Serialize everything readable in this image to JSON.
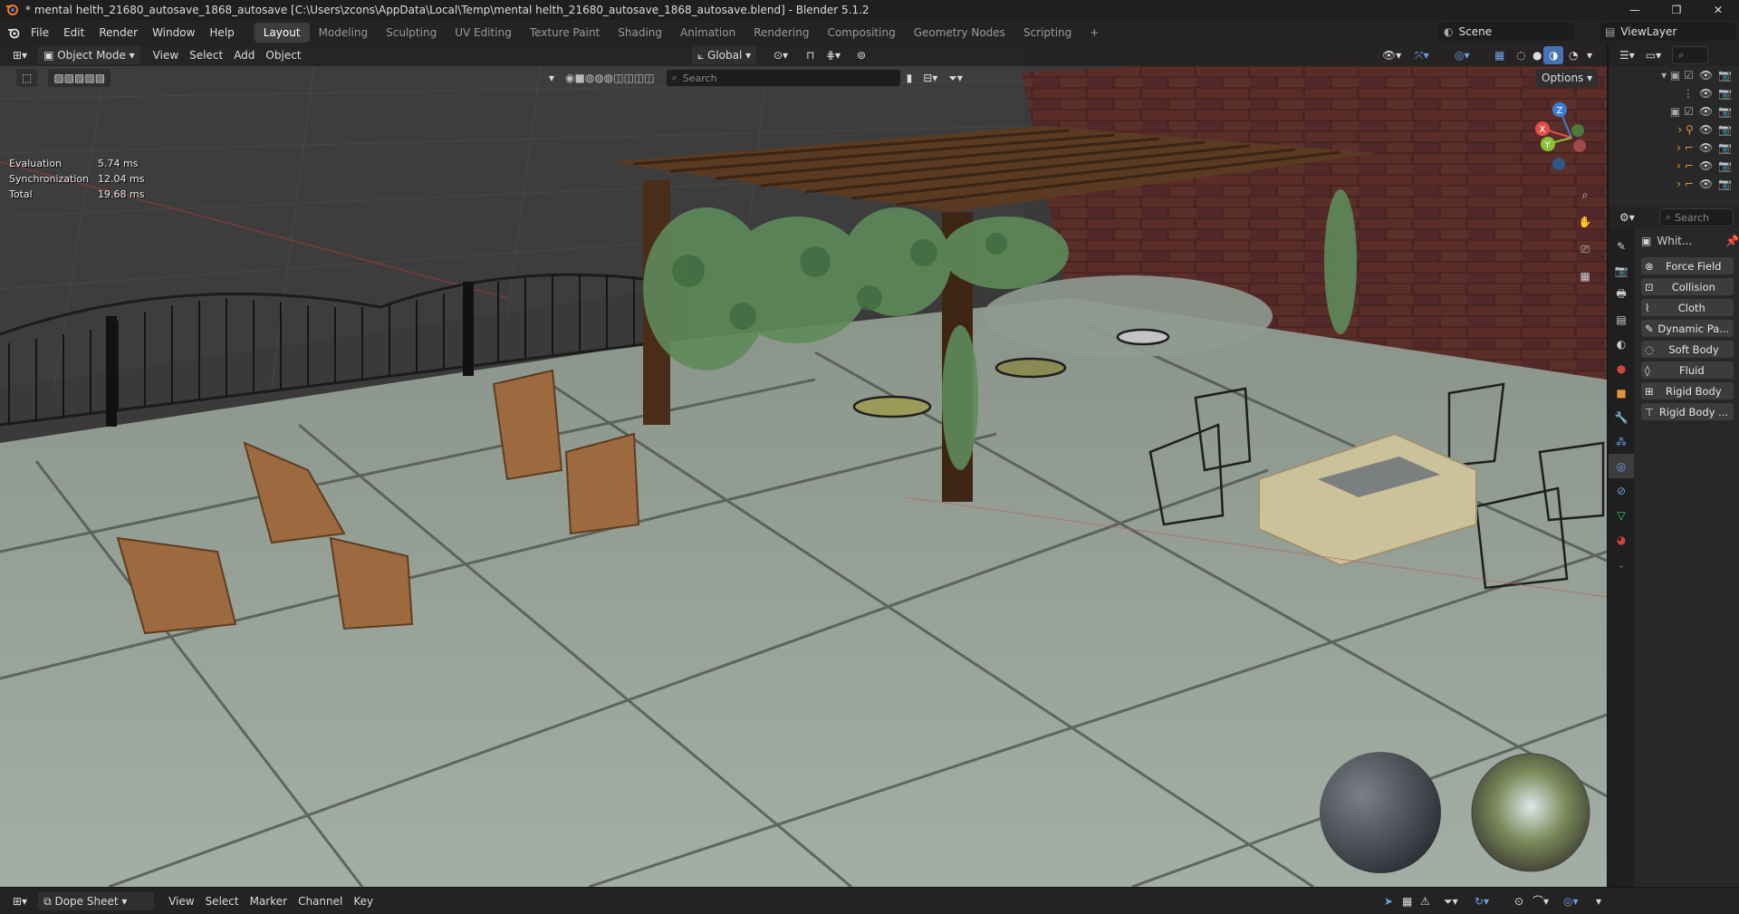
{
  "window": {
    "title": "* mental helth_21680_autosave_1868_autosave [C:\\Users\\zcons\\AppData\\Local\\Temp\\mental helth_21680_autosave_1868_autosave.blend] - Blender 5.1.2",
    "minimize": "—",
    "maximize": "❐",
    "close": "✕"
  },
  "menu": [
    "File",
    "Edit",
    "Render",
    "Window",
    "Help"
  ],
  "workspaces": [
    {
      "label": "Layout",
      "active": true
    },
    {
      "label": "Modeling"
    },
    {
      "label": "Sculpting"
    },
    {
      "label": "UV Editing"
    },
    {
      "label": "Texture Paint"
    },
    {
      "label": "Shading"
    },
    {
      "label": "Animation"
    },
    {
      "label": "Rendering"
    },
    {
      "label": "Compositing"
    },
    {
      "label": "Geometry Nodes"
    },
    {
      "label": "Scripting"
    }
  ],
  "add_workspace": "+",
  "scene": {
    "name": "Scene"
  },
  "view_layer": {
    "name": "ViewLayer"
  },
  "viewport_header": {
    "mode": "Object Mode",
    "menus": [
      "View",
      "Select",
      "Add",
      "Object"
    ],
    "transform_orientation": "Global",
    "options": "Options"
  },
  "viewport_search": {
    "placeholder": "Search"
  },
  "stats": [
    {
      "label": "Evaluation",
      "value": "5.74 ms"
    },
    {
      "label": "Synchronization",
      "value": "12.04 ms"
    },
    {
      "label": "Total",
      "value": "19.68 ms"
    }
  ],
  "gizmo": {
    "x": "X",
    "y": "Y",
    "z": "Z"
  },
  "properties": {
    "search_placeholder": "Search",
    "object_name": "Whit...",
    "physics_buttons": [
      "Force Field",
      "Collision",
      "Cloth",
      "Dynamic Pa...",
      "Soft Body",
      "Fluid",
      "Rigid Body",
      "Rigid Body ..."
    ]
  },
  "timeline": {
    "editor": "Dope Sheet",
    "menus": [
      "View",
      "Select",
      "Marker",
      "Channel",
      "Key"
    ]
  },
  "colors": {
    "ui_bg": "#232323",
    "active_tab": "#3d3d3d",
    "accent_blue": "#4772b3",
    "axis_x": "#e0504a",
    "axis_y": "#8ac23a",
    "axis_z": "#3c7fd6"
  }
}
